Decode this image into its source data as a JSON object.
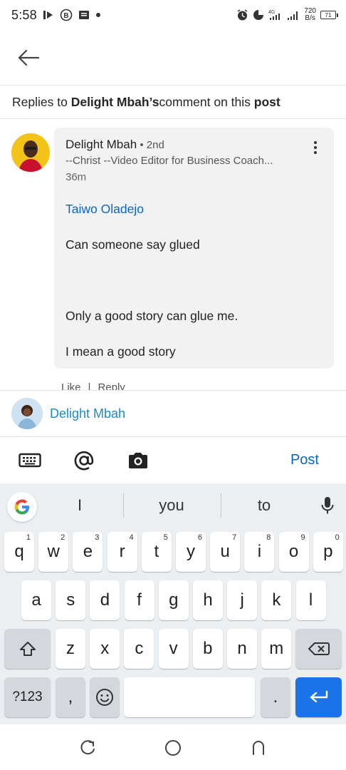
{
  "status_bar": {
    "time": "5:58",
    "net_speed_value": "720",
    "net_speed_unit": "B/s",
    "network_type": "4G",
    "battery": "71"
  },
  "header": {
    "back_icon": "arrow-left-icon"
  },
  "context": {
    "prefix": "Replies to ",
    "author": "Delight Mbah’s",
    "middle": " comment on this ",
    "target": "post"
  },
  "comment": {
    "author": "Delight Mbah",
    "degree": " • 2nd",
    "headline": "--Christ --Video Editor for Business Coach...",
    "time": "36m",
    "mention": "Taiwo Oladejo",
    "line1": "Can someone say glued",
    "line2": "Only a good story can glue me.",
    "line3": "I mean a good story",
    "like_label": "Like",
    "separator": "|",
    "reply_label": "Reply"
  },
  "composer": {
    "name": "Delight Mbah"
  },
  "toolbar": {
    "post_label": "Post",
    "accent_color": "#0a66c2"
  },
  "keyboard": {
    "suggestions": [
      "I",
      "you",
      "to"
    ],
    "row1": [
      {
        "k": "q",
        "h": "1"
      },
      {
        "k": "w",
        "h": "2"
      },
      {
        "k": "e",
        "h": "3"
      },
      {
        "k": "r",
        "h": "4"
      },
      {
        "k": "t",
        "h": "5"
      },
      {
        "k": "y",
        "h": "6"
      },
      {
        "k": "u",
        "h": "7"
      },
      {
        "k": "i",
        "h": "8"
      },
      {
        "k": "o",
        "h": "9"
      },
      {
        "k": "p",
        "h": "0"
      }
    ],
    "row2": [
      "a",
      "s",
      "d",
      "f",
      "g",
      "h",
      "j",
      "k",
      "l"
    ],
    "row3": [
      "z",
      "x",
      "c",
      "v",
      "b",
      "n",
      "m"
    ],
    "symbols_label": "?123",
    "comma_label": ",",
    "period_label": "."
  }
}
